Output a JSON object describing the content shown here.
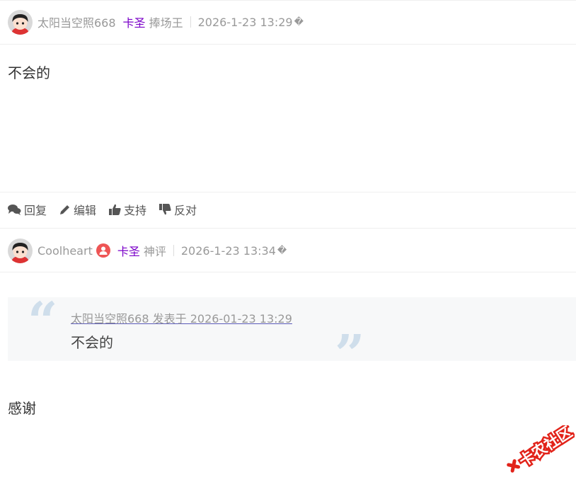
{
  "posts": [
    {
      "author": "太阳当空照668",
      "role": "卡圣",
      "title": "捧场王",
      "date": "2026-1-23 13:29",
      "qmark": "�",
      "content": "不会的"
    },
    {
      "author": "Coolheart",
      "role": "卡圣",
      "title": "神评",
      "date": "2026-1-23 13:34",
      "qmark": "�",
      "quote": {
        "source": "太阳当空照668 发表于 2026-01-23 13:29",
        "text": "不会的",
        "open_mark": "“",
        "close_mark": "”"
      },
      "content": "感谢"
    }
  ],
  "actions": {
    "reply": "回复",
    "edit": "编辑",
    "support": "支持",
    "oppose": "反对"
  },
  "icons": {
    "reply": "chat-bubbles-icon",
    "edit": "pencil-icon",
    "support": "thumbs-up-icon",
    "oppose": "thumbs-down-icon",
    "badge": "user-badge-icon"
  },
  "logo": {
    "text": "卡农社区",
    "color": "#e2231a"
  }
}
